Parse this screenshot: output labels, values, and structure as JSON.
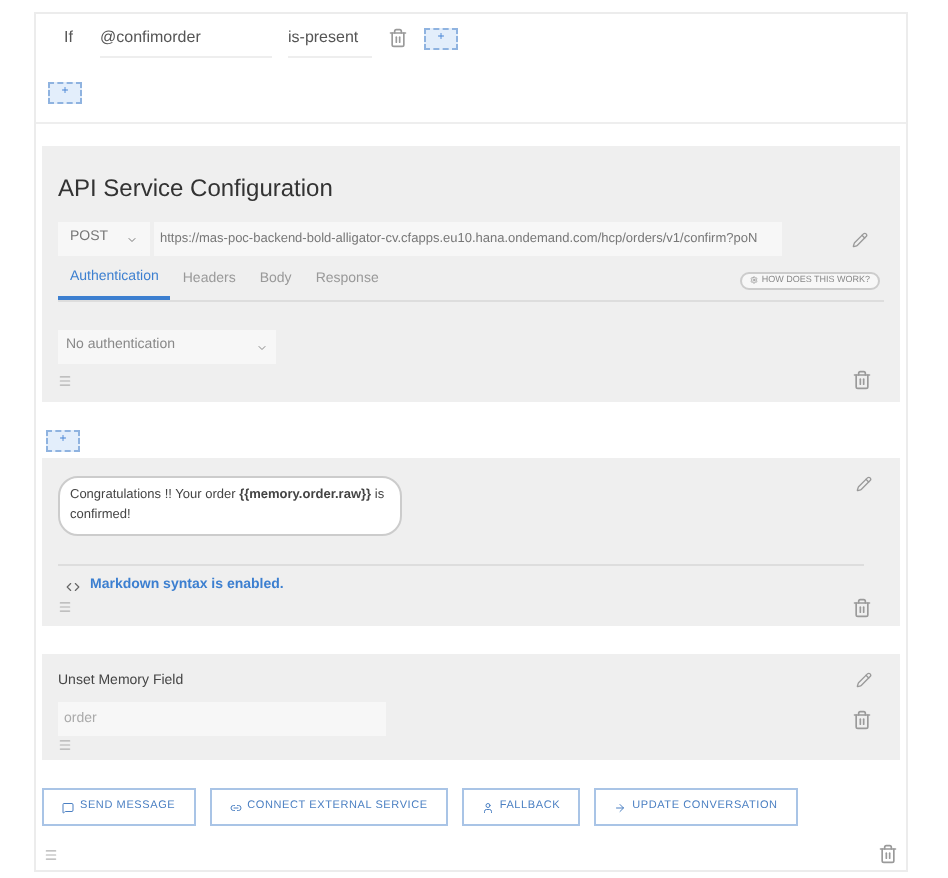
{
  "condition": {
    "keyword": "If",
    "variable": "@confimorder",
    "operator": "is-present",
    "add_label": "+"
  },
  "add_condition_label": "+",
  "api_service": {
    "title": "API Service Configuration",
    "method": "POST",
    "url": "https://mas-poc-backend-bold-alligator-cv.cfapps.eu10.hana.ondemand.com/hcp/orders/v1/confirm?poN",
    "tabs": [
      {
        "label": "Authentication",
        "selected": true
      },
      {
        "label": "Headers",
        "selected": false
      },
      {
        "label": "Body",
        "selected": false
      },
      {
        "label": "Response",
        "selected": false
      }
    ],
    "help_label": "HOW DOES THIS WORK?",
    "auth_type": "No authentication"
  },
  "add_action_label": "+",
  "message": {
    "text": "Congratulations !! Your order **{{memory.order.raw}}** is confirmed!",
    "markdown_note": "Markdown syntax is enabled."
  },
  "unset_memory": {
    "title": "Unset Memory Field",
    "placeholder": "order"
  },
  "actions": [
    {
      "kind": "message",
      "label": "SEND MESSAGE"
    },
    {
      "kind": "link",
      "label": "CONNECT EXTERNAL SERVICE"
    },
    {
      "kind": "person",
      "label": "FALLBACK"
    },
    {
      "kind": "arrow",
      "label": "UPDATE CONVERSATION"
    }
  ]
}
